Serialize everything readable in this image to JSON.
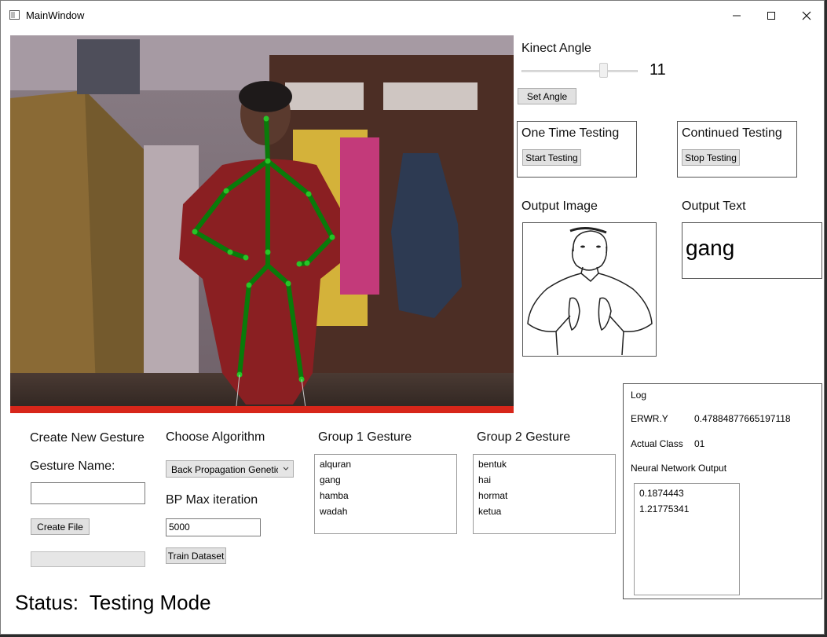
{
  "window": {
    "title": "MainWindow",
    "minimize": "—",
    "maximize": "☐",
    "close": "✕"
  },
  "kinect": {
    "label": "Kinect Angle",
    "angle_value": "11",
    "slider_fraction": 0.72,
    "set_button": "Set Angle"
  },
  "one_time": {
    "label": "One Time Testing",
    "button": "Start Testing"
  },
  "continued": {
    "label": "Continued Testing",
    "button": "Stop Testing"
  },
  "output": {
    "image_label": "Output Image",
    "text_label": "Output Text",
    "text_value": "gang"
  },
  "create": {
    "heading": "Create New Gesture",
    "name_label": "Gesture Name:",
    "name_value": "",
    "create_button": "Create File"
  },
  "algorithm": {
    "heading": "Choose Algorithm",
    "selected": "Back Propagation Genetic",
    "max_iter_label": "BP Max iteration",
    "max_iter_value": "5000",
    "train_button": "Train Dataset"
  },
  "group1": {
    "heading": "Group 1 Gesture",
    "items": [
      "alquran",
      "gang",
      "hamba",
      "wadah"
    ]
  },
  "group2": {
    "heading": "Group 2 Gesture",
    "items": [
      "bentuk",
      "hai",
      "hormat",
      "ketua"
    ]
  },
  "log": {
    "title": "Log",
    "erwr_label": "ERWR.Y",
    "erwr_value": "0.47884877665197118",
    "actual_label": "Actual Class",
    "actual_value": "01",
    "nn_label": "Neural Network Output",
    "nn_values": [
      "0.1874443",
      "1.21775341"
    ]
  },
  "status": {
    "label": "Status:",
    "value": "Testing Mode"
  },
  "colors": {
    "skeleton": "#0a7a0a",
    "joint": "#27c427",
    "window_bg": "#ffffff",
    "button_bg": "#e1e1e1"
  },
  "icons": {
    "app": "window-icon"
  }
}
